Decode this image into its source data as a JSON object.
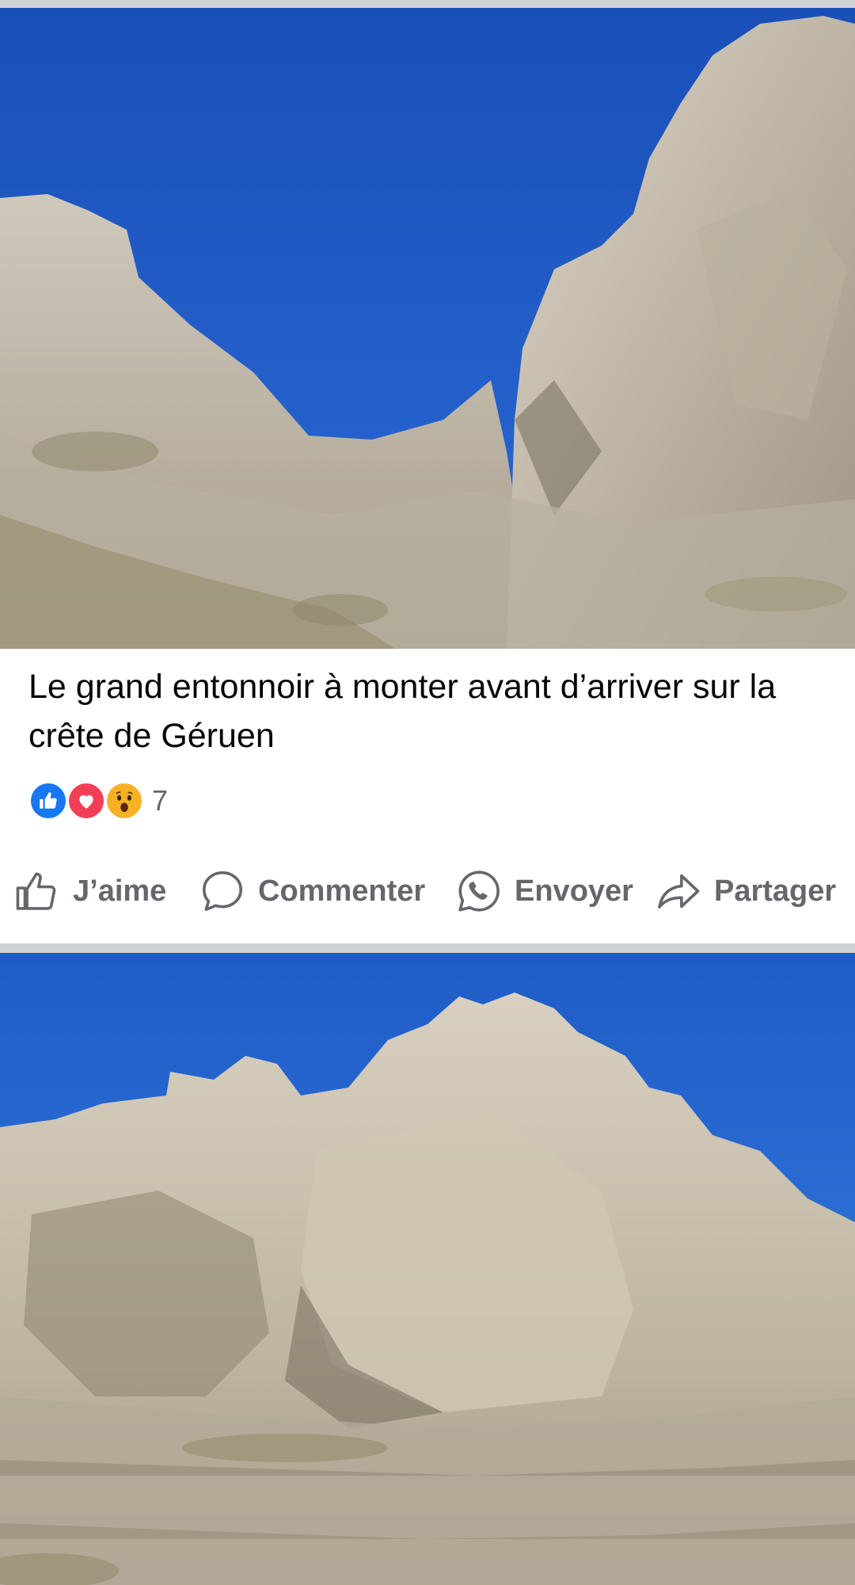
{
  "post1": {
    "photo_icon": "mountain-funnel-photo",
    "caption": "Le grand entonnoir à monter avant d’arriver sur la crête de Géruen",
    "reactions": {
      "icons": [
        "like-reaction-icon",
        "love-reaction-icon",
        "wow-reaction-icon"
      ],
      "count": "7"
    },
    "actions": {
      "like_label": "J’aime",
      "comment_label": "Commenter",
      "send_label": "Envoyer",
      "share_label": "Partager"
    }
  },
  "post2": {
    "photo_icon": "rock-cliff-photo"
  },
  "colors": {
    "sky": "#1f5fc4",
    "rock": "#c8c0b2",
    "like": "#1877f2",
    "love": "#f33e58",
    "wow": "#f7b125",
    "action_text": "#65676b",
    "divider": "#cfd1d5"
  }
}
